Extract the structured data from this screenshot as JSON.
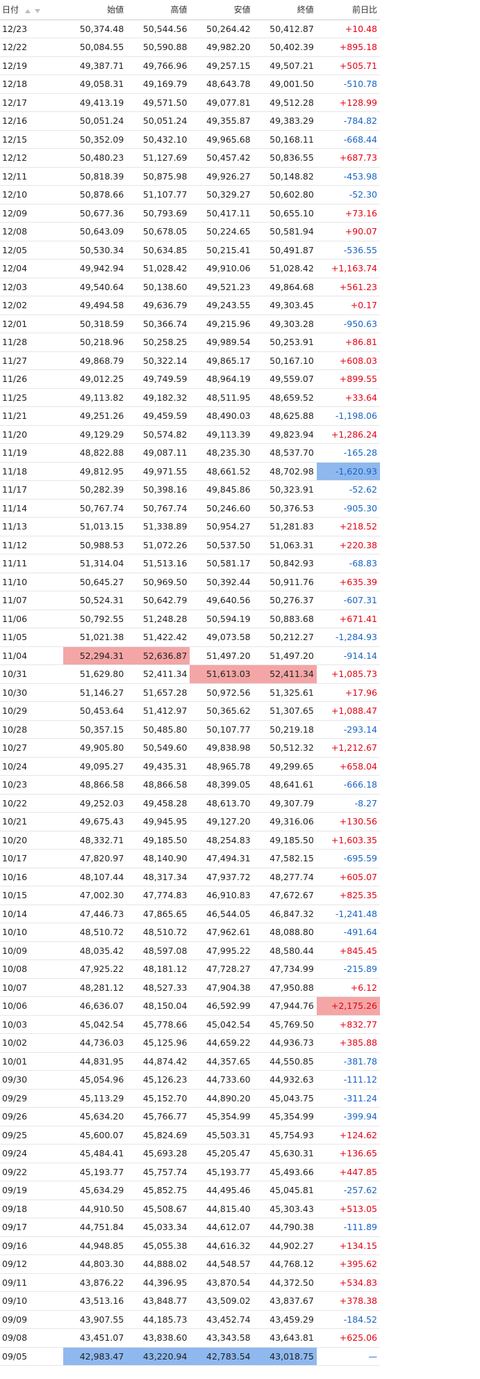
{
  "headers": {
    "date": "日付",
    "open": "始値",
    "high": "高値",
    "low": "安値",
    "close": "終値",
    "change": "前日比"
  },
  "colors": {
    "positive": "#e60012",
    "negative": "#1764c6",
    "highlight_red": "#f4a6a6",
    "highlight_blue": "#8fb8ee"
  },
  "rows": [
    {
      "date": "12/23",
      "open": "50,374.48",
      "high": "50,544.56",
      "low": "50,264.42",
      "close": "50,412.87",
      "change": "+10.48"
    },
    {
      "date": "12/22",
      "open": "50,084.55",
      "high": "50,590.88",
      "low": "49,982.20",
      "close": "50,402.39",
      "change": "+895.18"
    },
    {
      "date": "12/19",
      "open": "49,387.71",
      "high": "49,766.96",
      "low": "49,257.15",
      "close": "49,507.21",
      "change": "+505.71"
    },
    {
      "date": "12/18",
      "open": "49,058.31",
      "high": "49,169.79",
      "low": "48,643.78",
      "close": "49,001.50",
      "change": "-510.78"
    },
    {
      "date": "12/17",
      "open": "49,413.19",
      "high": "49,571.50",
      "low": "49,077.81",
      "close": "49,512.28",
      "change": "+128.99"
    },
    {
      "date": "12/16",
      "open": "50,051.24",
      "high": "50,051.24",
      "low": "49,355.87",
      "close": "49,383.29",
      "change": "-784.82"
    },
    {
      "date": "12/15",
      "open": "50,352.09",
      "high": "50,432.10",
      "low": "49,965.68",
      "close": "50,168.11",
      "change": "-668.44"
    },
    {
      "date": "12/12",
      "open": "50,480.23",
      "high": "51,127.69",
      "low": "50,457.42",
      "close": "50,836.55",
      "change": "+687.73"
    },
    {
      "date": "12/11",
      "open": "50,818.39",
      "high": "50,875.98",
      "low": "49,926.27",
      "close": "50,148.82",
      "change": "-453.98"
    },
    {
      "date": "12/10",
      "open": "50,878.66",
      "high": "51,107.77",
      "low": "50,329.27",
      "close": "50,602.80",
      "change": "-52.30"
    },
    {
      "date": "12/09",
      "open": "50,677.36",
      "high": "50,793.69",
      "low": "50,417.11",
      "close": "50,655.10",
      "change": "+73.16"
    },
    {
      "date": "12/08",
      "open": "50,643.09",
      "high": "50,678.05",
      "low": "50,224.65",
      "close": "50,581.94",
      "change": "+90.07"
    },
    {
      "date": "12/05",
      "open": "50,530.34",
      "high": "50,634.85",
      "low": "50,215.41",
      "close": "50,491.87",
      "change": "-536.55"
    },
    {
      "date": "12/04",
      "open": "49,942.94",
      "high": "51,028.42",
      "low": "49,910.06",
      "close": "51,028.42",
      "change": "+1,163.74"
    },
    {
      "date": "12/03",
      "open": "49,540.64",
      "high": "50,138.60",
      "low": "49,521.23",
      "close": "49,864.68",
      "change": "+561.23"
    },
    {
      "date": "12/02",
      "open": "49,494.58",
      "high": "49,636.79",
      "low": "49,243.55",
      "close": "49,303.45",
      "change": "+0.17"
    },
    {
      "date": "12/01",
      "open": "50,318.59",
      "high": "50,366.74",
      "low": "49,215.96",
      "close": "49,303.28",
      "change": "-950.63"
    },
    {
      "date": "11/28",
      "open": "50,218.96",
      "high": "50,258.25",
      "low": "49,989.54",
      "close": "50,253.91",
      "change": "+86.81"
    },
    {
      "date": "11/27",
      "open": "49,868.79",
      "high": "50,322.14",
      "low": "49,865.17",
      "close": "50,167.10",
      "change": "+608.03"
    },
    {
      "date": "11/26",
      "open": "49,012.25",
      "high": "49,749.59",
      "low": "48,964.19",
      "close": "49,559.07",
      "change": "+899.55"
    },
    {
      "date": "11/25",
      "open": "49,113.82",
      "high": "49,182.32",
      "low": "48,511.95",
      "close": "48,659.52",
      "change": "+33.64"
    },
    {
      "date": "11/21",
      "open": "49,251.26",
      "high": "49,459.59",
      "low": "48,490.03",
      "close": "48,625.88",
      "change": "-1,198.06"
    },
    {
      "date": "11/20",
      "open": "49,129.29",
      "high": "50,574.82",
      "low": "49,113.39",
      "close": "49,823.94",
      "change": "+1,286.24"
    },
    {
      "date": "11/19",
      "open": "48,822.88",
      "high": "49,087.11",
      "low": "48,235.30",
      "close": "48,537.70",
      "change": "-165.28"
    },
    {
      "date": "11/18",
      "open": "49,812.95",
      "high": "49,971.55",
      "low": "48,661.52",
      "close": "48,702.98",
      "change": "-1,620.93",
      "hl": {
        "change": "blue"
      }
    },
    {
      "date": "11/17",
      "open": "50,282.39",
      "high": "50,398.16",
      "low": "49,845.86",
      "close": "50,323.91",
      "change": "-52.62"
    },
    {
      "date": "11/14",
      "open": "50,767.74",
      "high": "50,767.74",
      "low": "50,246.60",
      "close": "50,376.53",
      "change": "-905.30"
    },
    {
      "date": "11/13",
      "open": "51,013.15",
      "high": "51,338.89",
      "low": "50,954.27",
      "close": "51,281.83",
      "change": "+218.52"
    },
    {
      "date": "11/12",
      "open": "50,988.53",
      "high": "51,072.26",
      "low": "50,537.50",
      "close": "51,063.31",
      "change": "+220.38"
    },
    {
      "date": "11/11",
      "open": "51,314.04",
      "high": "51,513.16",
      "low": "50,581.17",
      "close": "50,842.93",
      "change": "-68.83"
    },
    {
      "date": "11/10",
      "open": "50,645.27",
      "high": "50,969.50",
      "low": "50,392.44",
      "close": "50,911.76",
      "change": "+635.39"
    },
    {
      "date": "11/07",
      "open": "50,524.31",
      "high": "50,642.79",
      "low": "49,640.56",
      "close": "50,276.37",
      "change": "-607.31"
    },
    {
      "date": "11/06",
      "open": "50,792.55",
      "high": "51,248.28",
      "low": "50,594.19",
      "close": "50,883.68",
      "change": "+671.41"
    },
    {
      "date": "11/05",
      "open": "51,021.38",
      "high": "51,422.42",
      "low": "49,073.58",
      "close": "50,212.27",
      "change": "-1,284.93"
    },
    {
      "date": "11/04",
      "open": "52,294.31",
      "high": "52,636.87",
      "low": "51,497.20",
      "close": "51,497.20",
      "change": "-914.14",
      "hl": {
        "open": "red",
        "high": "red"
      }
    },
    {
      "date": "10/31",
      "open": "51,629.80",
      "high": "52,411.34",
      "low": "51,613.03",
      "close": "52,411.34",
      "change": "+1,085.73",
      "hl": {
        "low": "red",
        "close": "red"
      }
    },
    {
      "date": "10/30",
      "open": "51,146.27",
      "high": "51,657.28",
      "low": "50,972.56",
      "close": "51,325.61",
      "change": "+17.96"
    },
    {
      "date": "10/29",
      "open": "50,453.64",
      "high": "51,412.97",
      "low": "50,365.62",
      "close": "51,307.65",
      "change": "+1,088.47"
    },
    {
      "date": "10/28",
      "open": "50,357.15",
      "high": "50,485.80",
      "low": "50,107.77",
      "close": "50,219.18",
      "change": "-293.14"
    },
    {
      "date": "10/27",
      "open": "49,905.80",
      "high": "50,549.60",
      "low": "49,838.98",
      "close": "50,512.32",
      "change": "+1,212.67"
    },
    {
      "date": "10/24",
      "open": "49,095.27",
      "high": "49,435.31",
      "low": "48,965.78",
      "close": "49,299.65",
      "change": "+658.04"
    },
    {
      "date": "10/23",
      "open": "48,866.58",
      "high": "48,866.58",
      "low": "48,399.05",
      "close": "48,641.61",
      "change": "-666.18"
    },
    {
      "date": "10/22",
      "open": "49,252.03",
      "high": "49,458.28",
      "low": "48,613.70",
      "close": "49,307.79",
      "change": "-8.27"
    },
    {
      "date": "10/21",
      "open": "49,675.43",
      "high": "49,945.95",
      "low": "49,127.20",
      "close": "49,316.06",
      "change": "+130.56"
    },
    {
      "date": "10/20",
      "open": "48,332.71",
      "high": "49,185.50",
      "low": "48,254.83",
      "close": "49,185.50",
      "change": "+1,603.35"
    },
    {
      "date": "10/17",
      "open": "47,820.97",
      "high": "48,140.90",
      "low": "47,494.31",
      "close": "47,582.15",
      "change": "-695.59"
    },
    {
      "date": "10/16",
      "open": "48,107.44",
      "high": "48,317.34",
      "low": "47,937.72",
      "close": "48,277.74",
      "change": "+605.07"
    },
    {
      "date": "10/15",
      "open": "47,002.30",
      "high": "47,774.83",
      "low": "46,910.83",
      "close": "47,672.67",
      "change": "+825.35"
    },
    {
      "date": "10/14",
      "open": "47,446.73",
      "high": "47,865.65",
      "low": "46,544.05",
      "close": "46,847.32",
      "change": "-1,241.48"
    },
    {
      "date": "10/10",
      "open": "48,510.72",
      "high": "48,510.72",
      "low": "47,962.61",
      "close": "48,088.80",
      "change": "-491.64"
    },
    {
      "date": "10/09",
      "open": "48,035.42",
      "high": "48,597.08",
      "low": "47,995.22",
      "close": "48,580.44",
      "change": "+845.45"
    },
    {
      "date": "10/08",
      "open": "47,925.22",
      "high": "48,181.12",
      "low": "47,728.27",
      "close": "47,734.99",
      "change": "-215.89"
    },
    {
      "date": "10/07",
      "open": "48,281.12",
      "high": "48,527.33",
      "low": "47,904.38",
      "close": "47,950.88",
      "change": "+6.12"
    },
    {
      "date": "10/06",
      "open": "46,636.07",
      "high": "48,150.04",
      "low": "46,592.99",
      "close": "47,944.76",
      "change": "+2,175.26",
      "hl": {
        "change": "red"
      }
    },
    {
      "date": "10/03",
      "open": "45,042.54",
      "high": "45,778.66",
      "low": "45,042.54",
      "close": "45,769.50",
      "change": "+832.77"
    },
    {
      "date": "10/02",
      "open": "44,736.03",
      "high": "45,125.96",
      "low": "44,659.22",
      "close": "44,936.73",
      "change": "+385.88"
    },
    {
      "date": "10/01",
      "open": "44,831.95",
      "high": "44,874.42",
      "low": "44,357.65",
      "close": "44,550.85",
      "change": "-381.78"
    },
    {
      "date": "09/30",
      "open": "45,054.96",
      "high": "45,126.23",
      "low": "44,733.60",
      "close": "44,932.63",
      "change": "-111.12"
    },
    {
      "date": "09/29",
      "open": "45,113.29",
      "high": "45,152.70",
      "low": "44,890.20",
      "close": "45,043.75",
      "change": "-311.24"
    },
    {
      "date": "09/26",
      "open": "45,634.20",
      "high": "45,766.77",
      "low": "45,354.99",
      "close": "45,354.99",
      "change": "-399.94"
    },
    {
      "date": "09/25",
      "open": "45,600.07",
      "high": "45,824.69",
      "low": "45,503.31",
      "close": "45,754.93",
      "change": "+124.62"
    },
    {
      "date": "09/24",
      "open": "45,484.41",
      "high": "45,693.28",
      "low": "45,205.47",
      "close": "45,630.31",
      "change": "+136.65"
    },
    {
      "date": "09/22",
      "open": "45,193.77",
      "high": "45,757.74",
      "low": "45,193.77",
      "close": "45,493.66",
      "change": "+447.85"
    },
    {
      "date": "09/19",
      "open": "45,634.29",
      "high": "45,852.75",
      "low": "44,495.46",
      "close": "45,045.81",
      "change": "-257.62"
    },
    {
      "date": "09/18",
      "open": "44,910.50",
      "high": "45,508.67",
      "low": "44,815.40",
      "close": "45,303.43",
      "change": "+513.05"
    },
    {
      "date": "09/17",
      "open": "44,751.84",
      "high": "45,033.34",
      "low": "44,612.07",
      "close": "44,790.38",
      "change": "-111.89"
    },
    {
      "date": "09/16",
      "open": "44,948.85",
      "high": "45,055.38",
      "low": "44,616.32",
      "close": "44,902.27",
      "change": "+134.15"
    },
    {
      "date": "09/12",
      "open": "44,803.30",
      "high": "44,888.02",
      "low": "44,548.57",
      "close": "44,768.12",
      "change": "+395.62"
    },
    {
      "date": "09/11",
      "open": "43,876.22",
      "high": "44,396.95",
      "low": "43,870.54",
      "close": "44,372.50",
      "change": "+534.83"
    },
    {
      "date": "09/10",
      "open": "43,513.16",
      "high": "43,848.77",
      "low": "43,509.02",
      "close": "43,837.67",
      "change": "+378.38"
    },
    {
      "date": "09/09",
      "open": "43,907.55",
      "high": "44,185.73",
      "low": "43,452.74",
      "close": "43,459.29",
      "change": "-184.52"
    },
    {
      "date": "09/08",
      "open": "43,451.07",
      "high": "43,838.60",
      "low": "43,343.58",
      "close": "43,643.81",
      "change": "+625.06"
    },
    {
      "date": "09/05",
      "open": "42,983.47",
      "high": "43,220.94",
      "low": "42,783.54",
      "close": "43,018.75",
      "change": "—",
      "hl": {
        "open": "blue",
        "high": "blue",
        "low": "blue",
        "close": "blue"
      }
    }
  ]
}
